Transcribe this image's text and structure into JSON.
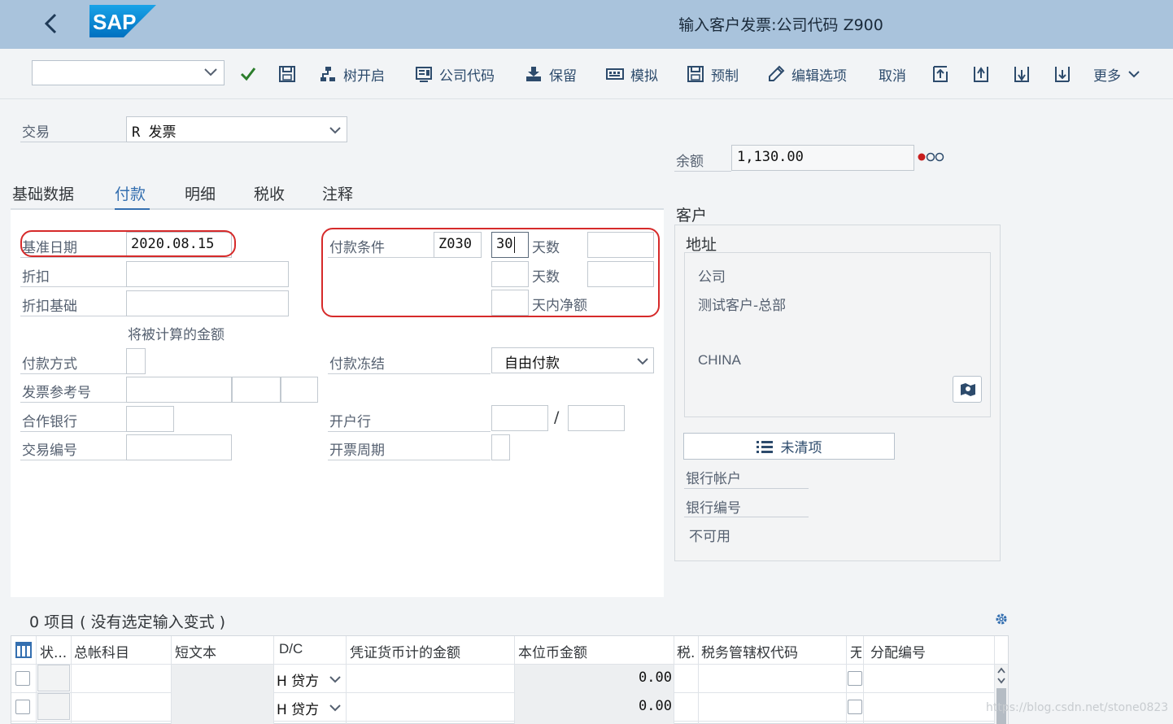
{
  "header": {
    "title": "输入客户发票:公司代码 Z900",
    "logo_text": "SAP"
  },
  "toolbar": {
    "tree_open": "树开启",
    "company_code": "公司代码",
    "park": "保留",
    "simulate": "模拟",
    "preliminary": "预制",
    "edit_options": "编辑选项",
    "cancel": "取消",
    "more": "更多"
  },
  "transaction": {
    "label": "交易",
    "value": "R 发票"
  },
  "balance": {
    "label": "余额",
    "value": "1,130.00"
  },
  "tabs": [
    "基础数据",
    "付款",
    "明细",
    "税收",
    "注释"
  ],
  "payment": {
    "baseline_date_label": "基准日期",
    "baseline_date": "2020.08.15",
    "discount_label": "折扣",
    "discount_base_label": "折扣基础",
    "calc_amount_note": "将被计算的金额",
    "payment_method_label": "付款方式",
    "invoice_ref_label": "发票参考号",
    "partner_bank_label": "合作银行",
    "transaction_no_label": "交易编号",
    "payment_terms_label": "付款条件",
    "payment_terms": "Z030",
    "days1": "30",
    "days_label": "天数",
    "days2_label": "天数",
    "net_days_label": "天内净额",
    "payment_block_label": "付款冻结",
    "payment_block": "自由付款",
    "house_bank_label": "开户行",
    "slash": "/",
    "invoice_period_label": "开票周期"
  },
  "customer": {
    "section_label": "客户",
    "address_label": "地址",
    "line1": "公司",
    "line2": "测试客户-总部",
    "country": "CHINA",
    "open_items": "未清项",
    "bank_account": "银行帐户",
    "bank_number": "银行编号",
    "unavailable": "不可用"
  },
  "items": {
    "title": "0 项目 ( 没有选定输入变式 )",
    "columns": [
      "状...",
      "总帐科目",
      "短文本",
      "D/C",
      "凭证货币计的金额",
      "本位币金额",
      "税.",
      "税务管辖权代码",
      "无",
      "分配编号"
    ],
    "rows": [
      {
        "dc": "H 贷方",
        "local_amount": "0.00"
      },
      {
        "dc": "H 贷方",
        "local_amount": "0.00"
      }
    ]
  },
  "watermark": "https://blog.csdn.net/stone0823"
}
